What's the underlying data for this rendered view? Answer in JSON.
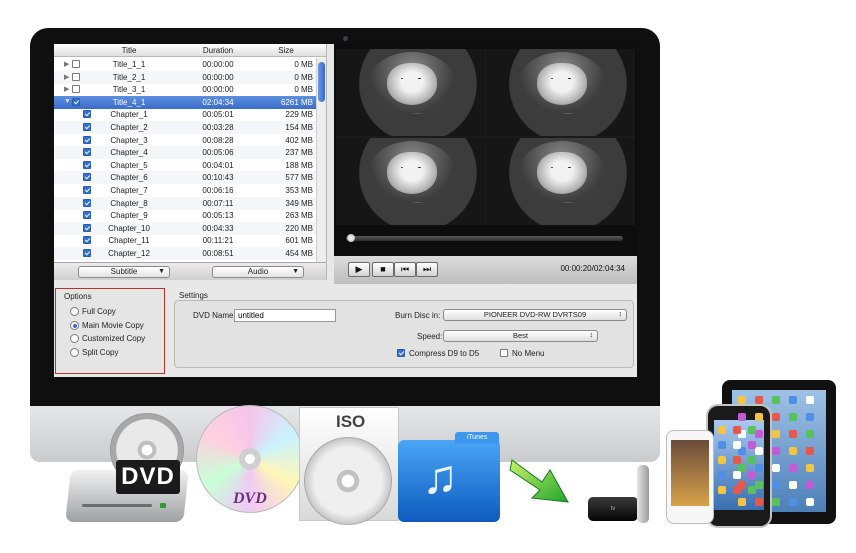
{
  "list": {
    "columns": {
      "title": "Title",
      "duration": "Duration",
      "size": "Size"
    },
    "rows": [
      {
        "title": "Title_1_1",
        "duration": "00:00:00",
        "size": "0 MB",
        "checked": false,
        "parent": true,
        "selected": false
      },
      {
        "title": "Title_2_1",
        "duration": "00:00:00",
        "size": "0 MB",
        "checked": false,
        "parent": true,
        "selected": false
      },
      {
        "title": "Title_3_1",
        "duration": "00:00:00",
        "size": "0 MB",
        "checked": false,
        "parent": true,
        "selected": false
      },
      {
        "title": "Title_4_1",
        "duration": "02:04:34",
        "size": "6261 MB",
        "checked": true,
        "parent": true,
        "selected": true
      },
      {
        "title": "Chapter_1",
        "duration": "00:05:01",
        "size": "229 MB",
        "checked": true
      },
      {
        "title": "Chapter_2",
        "duration": "00:03:28",
        "size": "154 MB",
        "checked": true
      },
      {
        "title": "Chapter_3",
        "duration": "00:08:28",
        "size": "402 MB",
        "checked": true
      },
      {
        "title": "Chapter_4",
        "duration": "00:05:06",
        "size": "237 MB",
        "checked": true
      },
      {
        "title": "Chapter_5",
        "duration": "00:04:01",
        "size": "188 MB",
        "checked": true
      },
      {
        "title": "Chapter_6",
        "duration": "00:10:43",
        "size": "577 MB",
        "checked": true
      },
      {
        "title": "Chapter_7",
        "duration": "00:06:16",
        "size": "353 MB",
        "checked": true
      },
      {
        "title": "Chapter_8",
        "duration": "00:07:11",
        "size": "349 MB",
        "checked": true
      },
      {
        "title": "Chapter_9",
        "duration": "00:05:13",
        "size": "263 MB",
        "checked": true
      },
      {
        "title": "Chapter_10",
        "duration": "00:04:33",
        "size": "220 MB",
        "checked": true
      },
      {
        "title": "Chapter_11",
        "duration": "00:11:21",
        "size": "601 MB",
        "checked": true
      },
      {
        "title": "Chapter_12",
        "duration": "00:08:51",
        "size": "454 MB",
        "checked": true
      }
    ],
    "subtitle_label": "Subtitle",
    "audio_label": "Audio"
  },
  "player": {
    "timecode": "00:00:20/02:04:34",
    "progress": 0.003,
    "icons": [
      "play-icon",
      "stop-icon",
      "previous-icon",
      "next-icon"
    ]
  },
  "options": {
    "title": "Options",
    "items": [
      "Full Copy",
      "Main Movie Copy",
      "Customized Copy",
      "Split Copy"
    ],
    "selected_index": 1
  },
  "settings": {
    "title": "Settings",
    "dvd_name_label": "DVD Name:",
    "dvd_name_value": "untitled",
    "burn_label": "Burn Disc in:",
    "burn_value": "PIONEER DVD-RW DVRTS09",
    "speed_label": "Speed:",
    "speed_value": "Best",
    "compress_label": "Compress D9 to D5",
    "compress_checked": true,
    "no_menu_label": "No Menu",
    "no_menu_checked": false
  },
  "products": {
    "dvd_tag": "DVD",
    "dvd_disc_label": "DVD",
    "iso_label": "ISO",
    "itunes_label": "iTunes",
    "appletv_label": "tv"
  },
  "colors": {
    "selection": "#3a6cc9",
    "options_border": "#b2342a",
    "accent": "#2f6fd6"
  }
}
